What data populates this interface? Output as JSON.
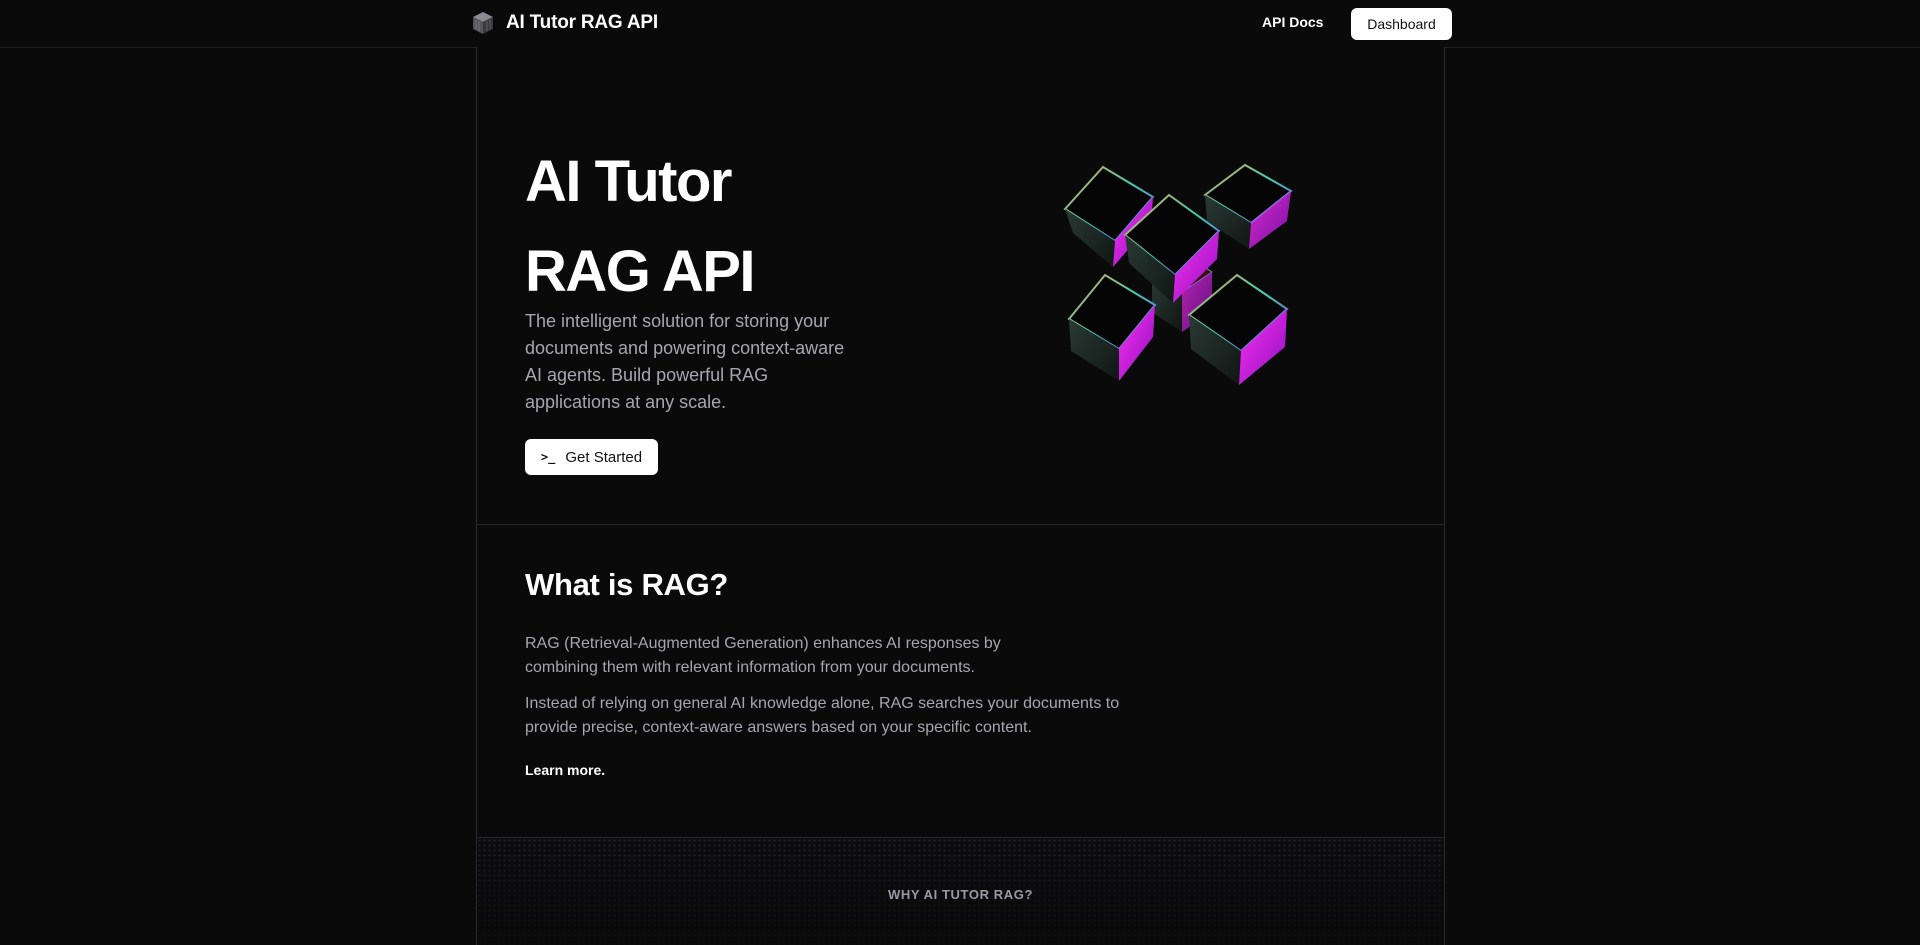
{
  "header": {
    "title": "AI Tutor RAG API",
    "logo_icon": "cube-logo-icon",
    "nav": {
      "docs_label": "API Docs",
      "dashboard_label": "Dashboard"
    }
  },
  "hero": {
    "title_line1": "AI Tutor",
    "title_line2": "RAG API",
    "description": "The intelligent solution for storing your documents and powering context-aware AI agents. Build powerful RAG applications at any scale.",
    "cta_icon": ">_",
    "cta_label": "Get Started",
    "illustration": "rainbow-cubes-illustration"
  },
  "rag_section": {
    "title": "What is RAG?",
    "paragraph1": "RAG (Retrieval-Augmented Generation) enhances AI responses by combining them with relevant information from your documents.",
    "paragraph2": "Instead of relying on general AI knowledge alone, RAG searches your documents to provide precise, context-aware answers based on your specific content.",
    "link_label": "Learn more."
  },
  "why_section": {
    "title": "WHY AI TUTOR RAG?"
  },
  "colors": {
    "background": "#0a0a0b",
    "text": "#ffffff",
    "muted_text": "#a6a6ad",
    "border": "#2a2a2e",
    "cube_magenta": "#e020f0",
    "cube_orange": "#f0a050",
    "cube_teal": "#40d0b0"
  }
}
